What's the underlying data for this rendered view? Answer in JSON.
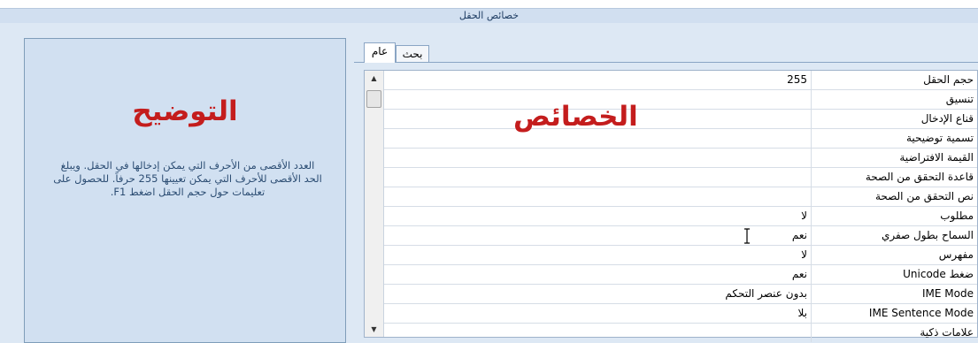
{
  "title": "خصائص الحقل",
  "tabs": [
    {
      "label": "عام",
      "selected": true
    },
    {
      "label": "بحث",
      "selected": false
    }
  ],
  "description": {
    "heading": "التوضيح",
    "text": "العدد الأقصى من الأحرف التي يمكن إدخالها في الحقل. ويبلغ الحد الأقصى للأحرف التي يمكن تعيينها 255 حرفاً. للحصول على تعليمات حول حجم الحقل اضغط F1."
  },
  "properties_heading": "الخصائص",
  "properties": [
    {
      "name": "حجم الحقل",
      "value": "255"
    },
    {
      "name": "تنسيق",
      "value": ""
    },
    {
      "name": "قناع الإدخال",
      "value": ""
    },
    {
      "name": "تسمية توضيحية",
      "value": ""
    },
    {
      "name": "القيمة الافتراضية",
      "value": ""
    },
    {
      "name": "قاعدة التحقق من الصحة",
      "value": ""
    },
    {
      "name": "نص التحقق من الصحة",
      "value": ""
    },
    {
      "name": "مطلوب",
      "value": "لا"
    },
    {
      "name": "السماح بطول صفري",
      "value": "نعم"
    },
    {
      "name": "مفهرس",
      "value": "لا"
    },
    {
      "name": "ضغط Unicode",
      "value": "نعم"
    },
    {
      "name": "IME Mode",
      "value": "بدون عنصر التحكم"
    },
    {
      "name": "IME Sentence Mode",
      "value": "بلا"
    },
    {
      "name": "علامات ذكية",
      "value": ""
    }
  ],
  "colors": {
    "accent_red": "#c41d1d",
    "title_bar": "#d1dff0",
    "panel_bg": "#dde8f4"
  }
}
